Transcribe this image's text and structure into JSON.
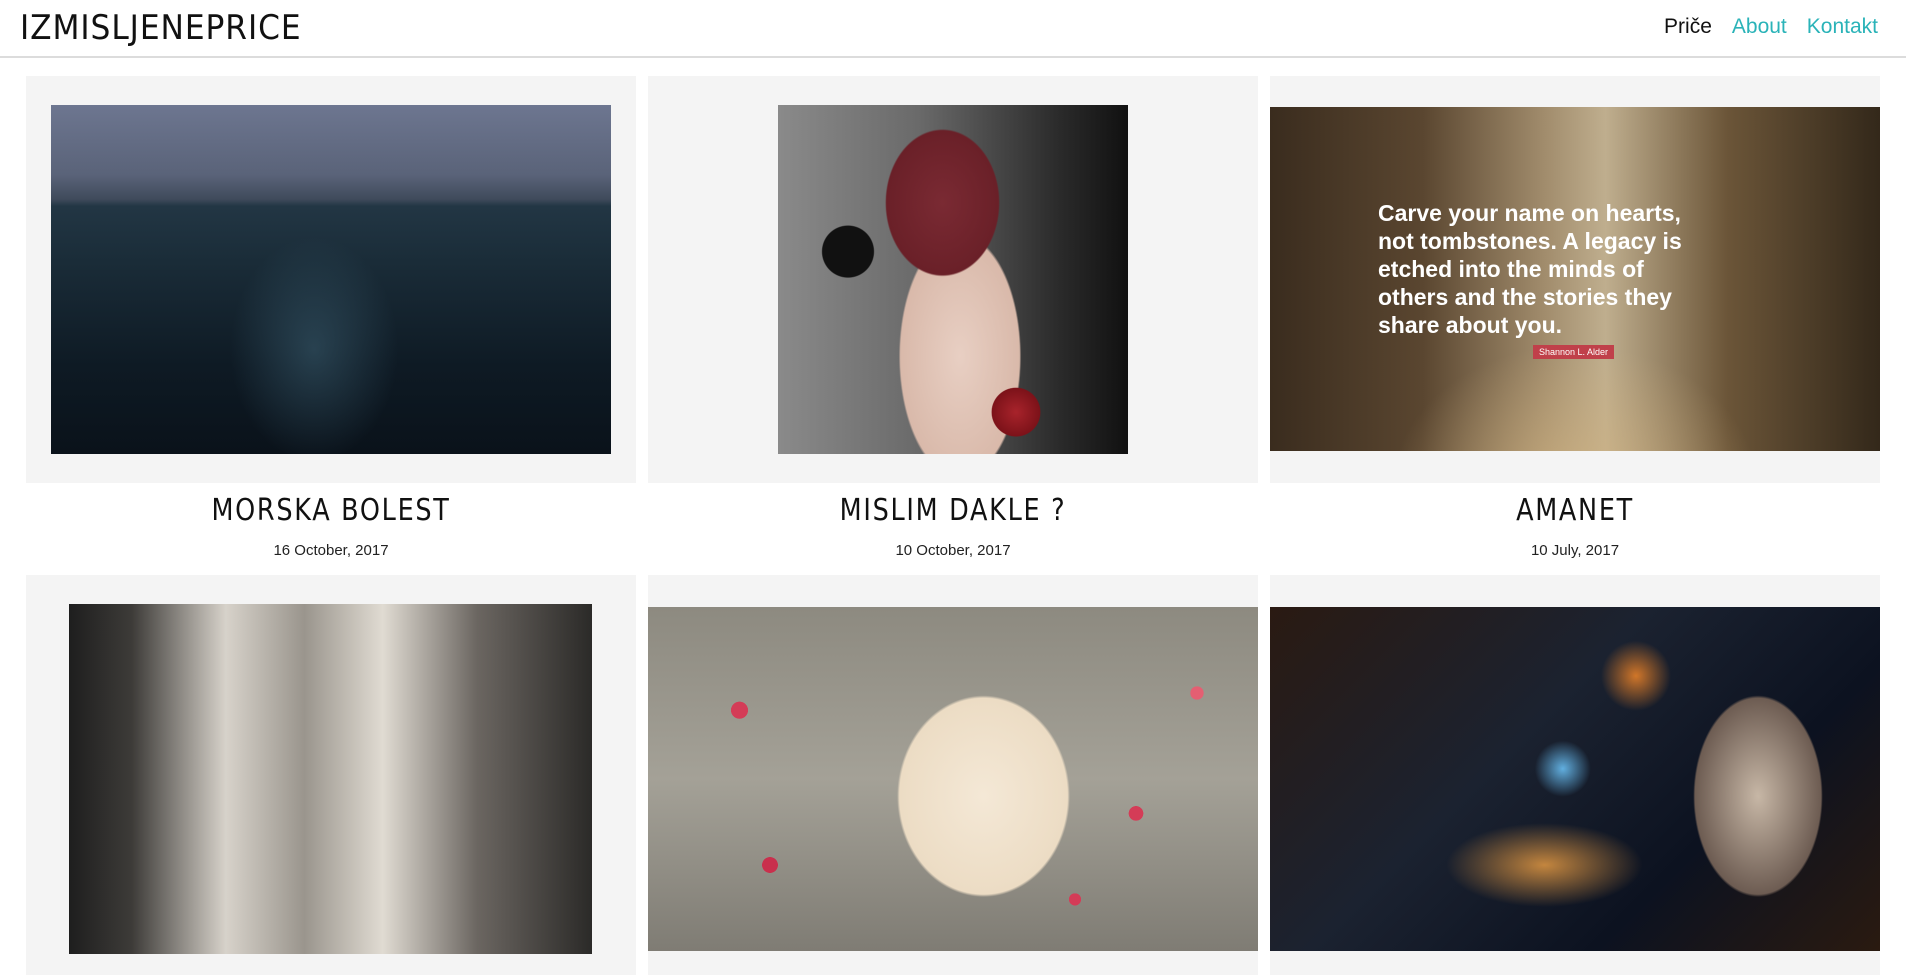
{
  "header": {
    "logo": "IZMISLJENEPRICE",
    "nav": [
      {
        "label": "Priče",
        "active": true
      },
      {
        "label": "About",
        "active": false
      },
      {
        "label": "Kontakt",
        "active": false
      }
    ]
  },
  "posts": [
    {
      "title": "Morska bolest",
      "date": "16 October, 2017"
    },
    {
      "title": "Mislim dakle ?",
      "date": "10 October, 2017"
    },
    {
      "title": "Amanet",
      "date": "10 July, 2017",
      "image_quote": "Carve your name on hearts, not tombstones. A legacy is etched into the minds of others and the stories they share about you.",
      "image_quote_author": "Shannon L. Alder"
    },
    {
      "title": "",
      "date": ""
    },
    {
      "title": "",
      "date": ""
    },
    {
      "title": "",
      "date": ""
    }
  ],
  "colors": {
    "accent": "#2ab3b8",
    "active_nav": "#111111",
    "card_bg": "#f4f4f4"
  }
}
